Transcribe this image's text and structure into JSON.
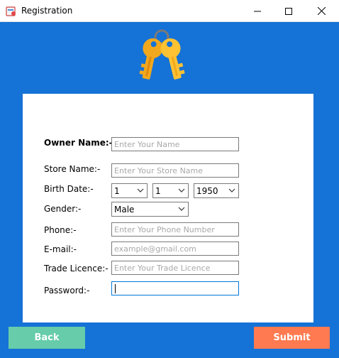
{
  "window": {
    "title": "Registration"
  },
  "colors": {
    "background": "#1572d6",
    "back_button": "#66ccaa",
    "submit_button": "#ff7a50"
  },
  "form": {
    "owner_name": {
      "label": "Owner Name:-",
      "placeholder": "Enter Your Name"
    },
    "store_name": {
      "label": "Store Name:-",
      "placeholder": "Enter Your Store Name"
    },
    "birth_date": {
      "label": "Birth Date:-",
      "day": "1",
      "month": "1",
      "year": "1950"
    },
    "gender": {
      "label": "Gender:-",
      "value": "Male"
    },
    "phone": {
      "label": "Phone:-",
      "placeholder": "Enter Your Phone Number"
    },
    "email": {
      "label": "E-mail:-",
      "placeholder": "example@gmail.com"
    },
    "trade_licence": {
      "label": "Trade Licence:-",
      "placeholder": "Enter Your Trade Licence"
    },
    "password": {
      "label": "Password:-",
      "value": ""
    }
  },
  "buttons": {
    "back": "Back",
    "submit": "Submit"
  },
  "icons": {
    "app": "app-icon",
    "header": "keys-icon"
  }
}
